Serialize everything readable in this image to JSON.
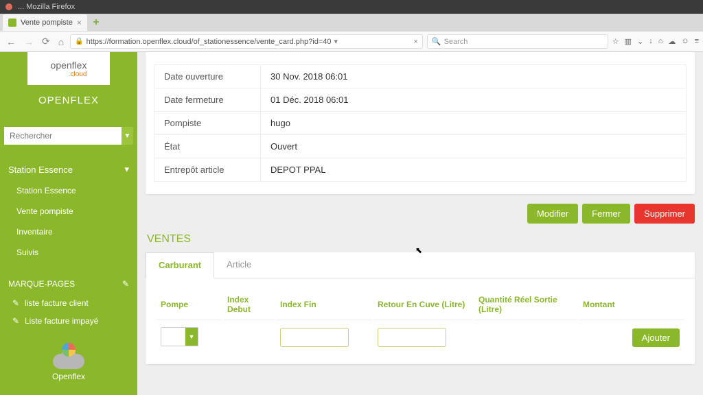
{
  "os": {
    "title": "... Mozilla Firefox"
  },
  "browser": {
    "tab_title": "Vente pompiste",
    "url_display": "https://formation.openflex.cloud/of_stationessence/vente_card.php?id=40",
    "search_placeholder": "Search"
  },
  "sidebar": {
    "brand": "OPENFLEX",
    "search_placeholder": "Rechercher",
    "section_title": "Station Essence",
    "items": [
      "Station Essence",
      "Vente pompiste",
      "Inventaire",
      "Suivis"
    ],
    "bookmarks_title": "MARQUE-PAGES",
    "bookmarks": [
      "liste facture client",
      "Liste facture impayé"
    ],
    "footer_label": "Openflex"
  },
  "info": {
    "rows": [
      {
        "label": "Date ouverture",
        "value": "30 Nov. 2018 06:01"
      },
      {
        "label": "Date fermeture",
        "value": "01 Déc. 2018 06:01"
      },
      {
        "label": "Pompiste",
        "value": "hugo"
      },
      {
        "label": "État",
        "value": "Ouvert"
      },
      {
        "label": "Entrepôt article",
        "value": "DEPOT PPAL"
      }
    ]
  },
  "actions": {
    "modifier": "Modifier",
    "fermer": "Fermer",
    "supprimer": "Supprimer"
  },
  "ventes": {
    "title": "VENTES",
    "tabs": {
      "carburant": "Carburant",
      "article": "Article"
    },
    "headers": [
      "Pompe",
      "Index Debut",
      "Index Fin",
      "Retour En Cuve (Litre)",
      "Quantité Réel Sortie (Litre)",
      "Montant"
    ],
    "add_button": "Ajouter"
  }
}
